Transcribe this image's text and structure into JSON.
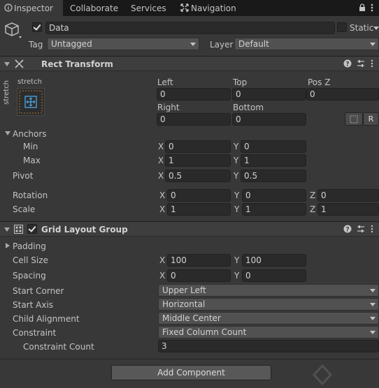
{
  "tabs": [
    {
      "label": "Inspector",
      "icon": "info-icon"
    },
    {
      "label": "Collaborate"
    },
    {
      "label": "Services"
    },
    {
      "label": "Navigation",
      "icon": "navigation-icon"
    }
  ],
  "object": {
    "name": "Data",
    "active": true,
    "static_label": "Static",
    "tag_label": "Tag",
    "tag_value": "Untagged",
    "layer_label": "Layer",
    "layer_value": "Default"
  },
  "rect_transform": {
    "title": "Rect Transform",
    "anchor_preset_top": "stretch",
    "anchor_preset_side": "stretch",
    "left_label": "Left",
    "top_label": "Top",
    "posz_label": "Pos Z",
    "left_value": "0",
    "top_value": "0",
    "posz_value": "0",
    "right_label": "Right",
    "bottom_label": "Bottom",
    "right_value": "0",
    "bottom_value": "0",
    "raw_label": "R",
    "anchors_label": "Anchors",
    "min_label": "Min",
    "min_x": "0",
    "min_y": "0",
    "max_label": "Max",
    "max_x": "1",
    "max_y": "1",
    "pivot_label": "Pivot",
    "pivot_x": "0.5",
    "pivot_y": "0.5",
    "rotation_label": "Rotation",
    "rotation_x": "0",
    "rotation_y": "0",
    "rotation_z": "0",
    "scale_label": "Scale",
    "scale_x": "1",
    "scale_y": "1",
    "scale_z": "1",
    "x": "X",
    "y": "Y",
    "z": "Z"
  },
  "grid_layout": {
    "title": "Grid Layout Group",
    "enabled": true,
    "padding_label": "Padding",
    "cell_size_label": "Cell Size",
    "cell_size_x": "100",
    "cell_size_y": "100",
    "spacing_label": "Spacing",
    "spacing_x": "0",
    "spacing_y": "0",
    "start_corner_label": "Start Corner",
    "start_corner_value": "Upper Left",
    "start_axis_label": "Start Axis",
    "start_axis_value": "Horizontal",
    "child_alignment_label": "Child Alignment",
    "child_alignment_value": "Middle Center",
    "constraint_label": "Constraint",
    "constraint_value": "Fixed Column Count",
    "constraint_count_label": "Constraint Count",
    "constraint_count_value": "3"
  },
  "add_component_label": "Add Component"
}
